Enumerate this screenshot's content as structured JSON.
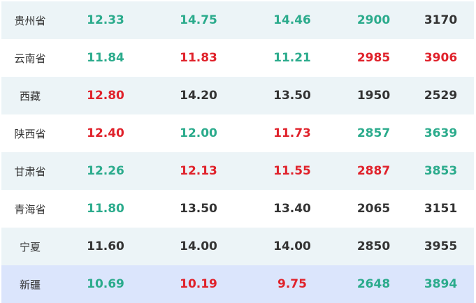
{
  "colors": {
    "green": "#2bab8c",
    "red": "#e0222b",
    "dark": "#333333",
    "row_alt": "#ecf4f7",
    "row_highlight": "#dbe5fc"
  },
  "rows": [
    {
      "region": "贵州省",
      "cells": [
        {
          "value": "12.33",
          "color": "green"
        },
        {
          "value": "14.75",
          "color": "green"
        },
        {
          "value": "14.46",
          "color": "green"
        },
        {
          "value": "2900",
          "color": "green"
        },
        {
          "value": "3170",
          "color": "dark"
        }
      ]
    },
    {
      "region": "云南省",
      "cells": [
        {
          "value": "11.84",
          "color": "green"
        },
        {
          "value": "11.83",
          "color": "red"
        },
        {
          "value": "11.21",
          "color": "green"
        },
        {
          "value": "2985",
          "color": "red"
        },
        {
          "value": "3906",
          "color": "red"
        }
      ]
    },
    {
      "region": "西藏",
      "cells": [
        {
          "value": "12.80",
          "color": "red"
        },
        {
          "value": "14.20",
          "color": "dark"
        },
        {
          "value": "13.50",
          "color": "dark"
        },
        {
          "value": "1950",
          "color": "dark"
        },
        {
          "value": "2529",
          "color": "dark"
        }
      ]
    },
    {
      "region": "陕西省",
      "cells": [
        {
          "value": "12.40",
          "color": "red"
        },
        {
          "value": "12.00",
          "color": "green"
        },
        {
          "value": "11.73",
          "color": "red"
        },
        {
          "value": "2857",
          "color": "green"
        },
        {
          "value": "3639",
          "color": "green"
        }
      ]
    },
    {
      "region": "甘肃省",
      "cells": [
        {
          "value": "12.26",
          "color": "green"
        },
        {
          "value": "12.13",
          "color": "red"
        },
        {
          "value": "11.55",
          "color": "red"
        },
        {
          "value": "2887",
          "color": "red"
        },
        {
          "value": "3853",
          "color": "green"
        }
      ]
    },
    {
      "region": "青海省",
      "cells": [
        {
          "value": "11.80",
          "color": "green"
        },
        {
          "value": "13.50",
          "color": "dark"
        },
        {
          "value": "13.40",
          "color": "dark"
        },
        {
          "value": "2065",
          "color": "dark"
        },
        {
          "value": "3151",
          "color": "dark"
        }
      ]
    },
    {
      "region": "宁夏",
      "cells": [
        {
          "value": "11.60",
          "color": "dark"
        },
        {
          "value": "14.00",
          "color": "dark"
        },
        {
          "value": "14.00",
          "color": "dark"
        },
        {
          "value": "2850",
          "color": "dark"
        },
        {
          "value": "3955",
          "color": "dark"
        }
      ]
    },
    {
      "region": "新疆",
      "cells": [
        {
          "value": "10.69",
          "color": "green"
        },
        {
          "value": "10.19",
          "color": "red"
        },
        {
          "value": "9.75",
          "color": "red"
        },
        {
          "value": "2648",
          "color": "green"
        },
        {
          "value": "3894",
          "color": "green"
        }
      ]
    }
  ]
}
